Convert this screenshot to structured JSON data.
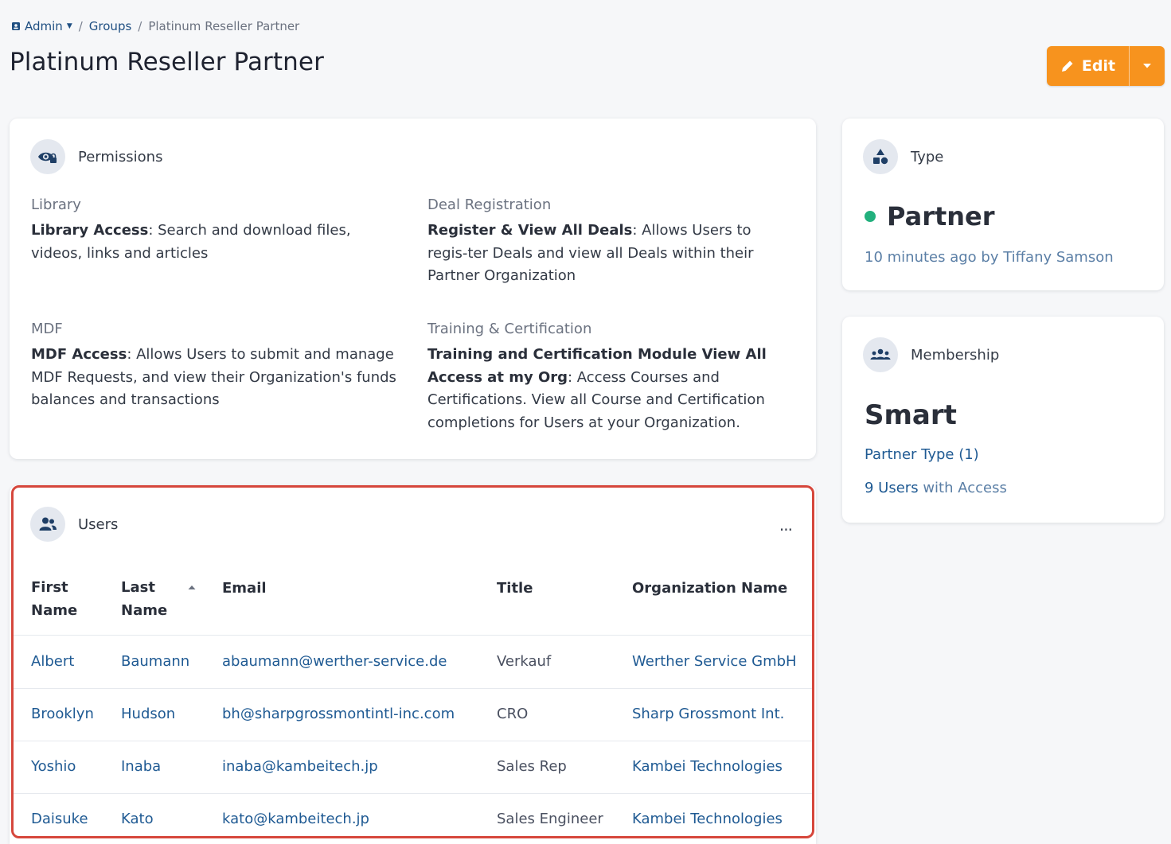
{
  "breadcrumb": {
    "admin": "Admin",
    "groups": "Groups",
    "current": "Platinum Reseller Partner"
  },
  "page": {
    "title": "Platinum Reseller Partner",
    "edit_label": "Edit"
  },
  "permissions": {
    "header": "Permissions",
    "sections": [
      {
        "label": "Library",
        "bold": "Library Access",
        "text": ": Search and download files, videos, links and articles"
      },
      {
        "label": "Deal Registration",
        "bold": "Register & View All Deals",
        "text": ": Allows Users to regis-ter Deals and view all Deals within their Partner Organization"
      },
      {
        "label": "MDF",
        "bold": "MDF Access",
        "text": ": Allows Users to submit and manage MDF Requests, and view their Organization's funds balances and transactions"
      },
      {
        "label": "Training & Certification",
        "bold": "Training and Certification Module View All Access at my Org",
        "text": ": Access Courses and Certifications. View all Course and Certification completions for Users at your Organization."
      }
    ]
  },
  "type_card": {
    "header": "Type",
    "value": "Partner",
    "meta": "10 minutes ago by Tiffany Samson",
    "status_color": "#22b07d"
  },
  "membership": {
    "header": "Membership",
    "value": "Smart",
    "partner_type": "Partner Type (1)",
    "users_count": "9 Users",
    "users_suffix": " with Access"
  },
  "users": {
    "header": "Users",
    "more": "···",
    "columns": {
      "first_name_1": "First",
      "first_name_2": "Name",
      "last_name_1": "Last",
      "last_name_2": "Name",
      "email": "Email",
      "title": "Title",
      "org": "Organization Name"
    },
    "rows": [
      {
        "first": "Albert",
        "last": "Baumann",
        "email": "abaumann@werther-service.de",
        "title": "Verkauf",
        "org": "Werther Service GmbH"
      },
      {
        "first": "Brooklyn",
        "last": "Hudson",
        "email": "bh@sharpgrossmontintl-inc.com",
        "title": "CRO",
        "org": "Sharp Grossmont Int."
      },
      {
        "first": "Yoshio",
        "last": "Inaba",
        "email": "inaba@kambeitech.jp",
        "title": "Sales Rep",
        "org": "Kambei Technologies"
      },
      {
        "first": "Daisuke",
        "last": "Kato",
        "email": "kato@kambeitech.jp",
        "title": "Sales Engineer",
        "org": "Kambei Technologies"
      }
    ]
  },
  "colors": {
    "accent_orange": "#f7931e",
    "link_blue": "#1f5a93",
    "highlight_red": "#d6473c"
  }
}
